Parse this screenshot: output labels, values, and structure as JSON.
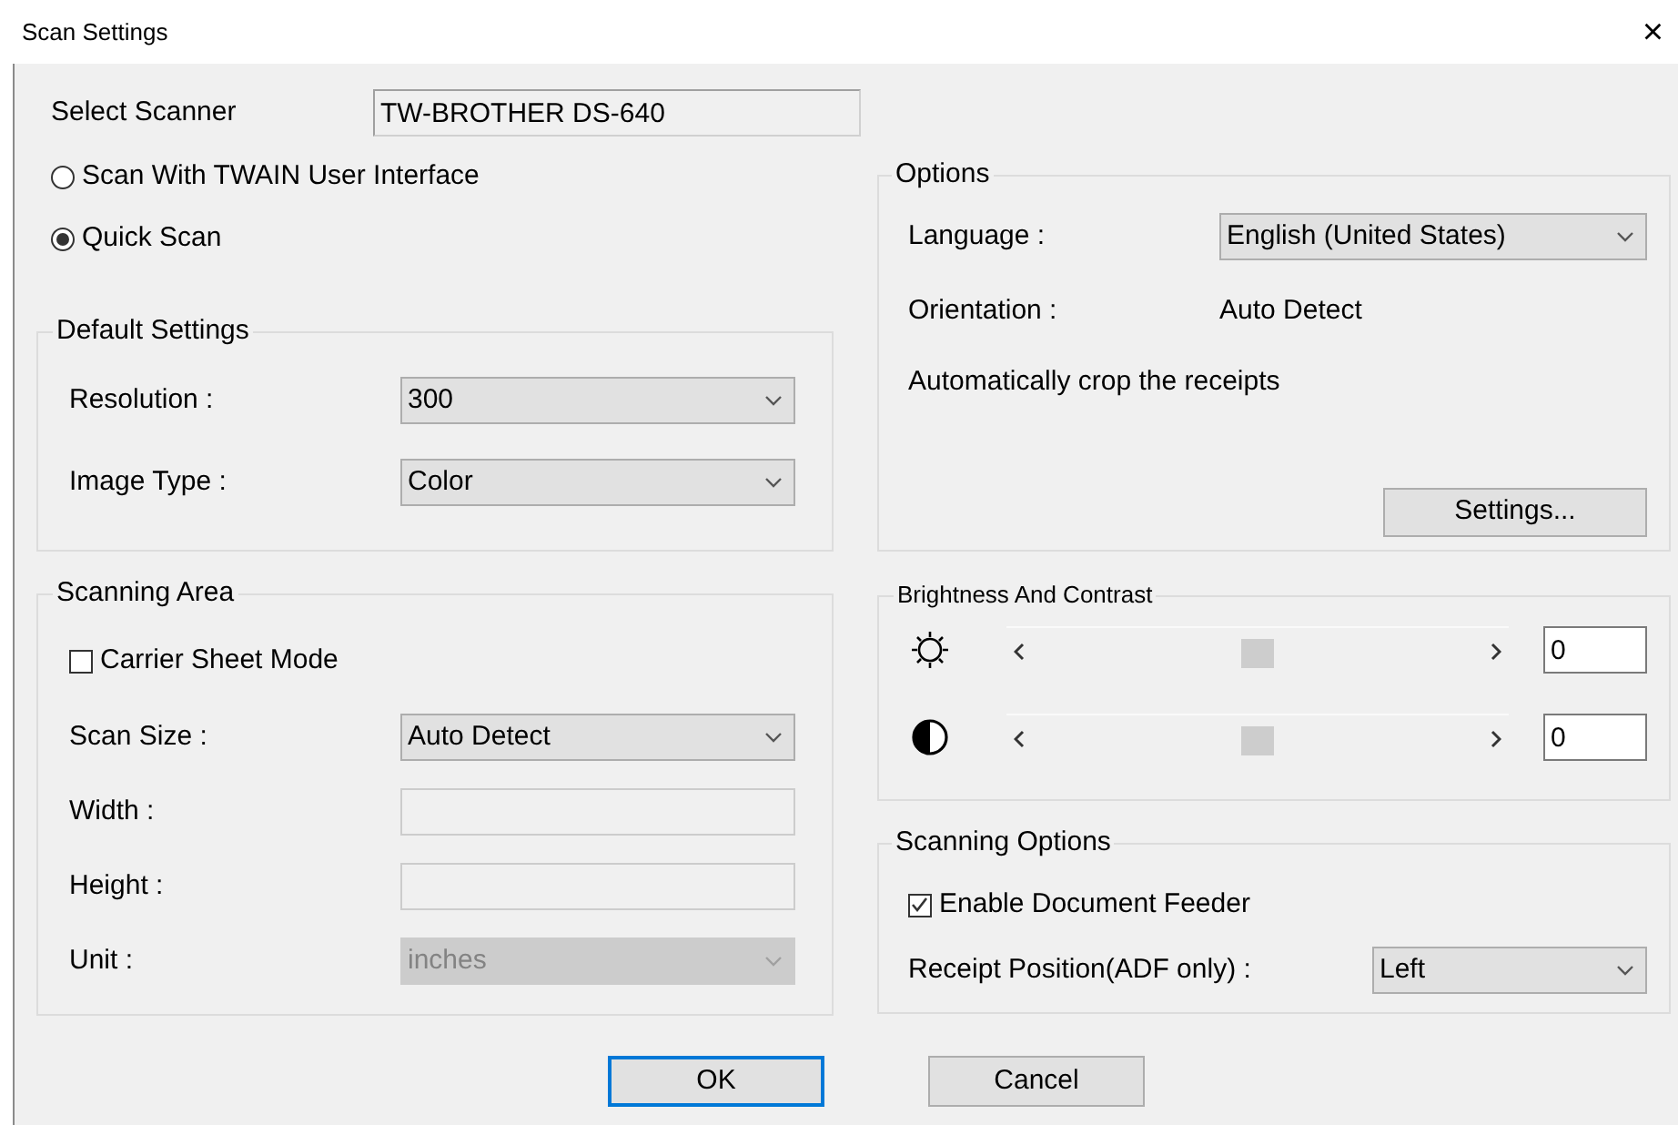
{
  "window": {
    "title": "Scan Settings",
    "close": "×"
  },
  "scanner": {
    "label": "Select Scanner",
    "value": "TW-BROTHER DS-640"
  },
  "scan_modes": [
    {
      "label": "Scan With TWAIN User Interface",
      "selected": false
    },
    {
      "label": "Quick Scan",
      "selected": true
    }
  ],
  "default_settings": {
    "title": "Default Settings",
    "fields": [
      {
        "label": "Resolution :",
        "kind": "dropdown",
        "value": "300",
        "disabled": false
      },
      {
        "label": "Image Type :",
        "kind": "dropdown",
        "value": "Color",
        "disabled": false
      }
    ]
  },
  "scanning_area": {
    "title": "Scanning Area",
    "carrier_sheet": {
      "label": "Carrier Sheet Mode",
      "checked": false
    },
    "fields": [
      {
        "label": "Scan Size :",
        "kind": "dropdown",
        "value": "Auto Detect",
        "disabled": false
      },
      {
        "label": "Width :",
        "kind": "text",
        "disabled": true
      },
      {
        "label": "Height :",
        "kind": "text",
        "disabled": true
      },
      {
        "label": "Unit :",
        "kind": "dropdown",
        "value": "inches",
        "disabled": true
      }
    ]
  },
  "options": {
    "title": "Options",
    "language": {
      "label": "Language :",
      "value": "English (United States)"
    },
    "orientation": {
      "label": "Orientation :",
      "value": "Auto Detect"
    },
    "note": "Automatically crop the receipts",
    "button": "Settings..."
  },
  "brightness_contrast": {
    "title": "Brightness And Contrast",
    "sliders": [
      {
        "kind": "brightness",
        "level": 0.5,
        "value": "0"
      },
      {
        "kind": "contrast",
        "level": 0.5,
        "value": "0"
      }
    ]
  },
  "scanning_options": {
    "title": "Scanning Options",
    "feeder": {
      "label": "Enable Document Feeder",
      "checked": true
    },
    "receipt_position": {
      "label": "Receipt Position(ADF only) :",
      "value": "Left"
    }
  },
  "buttons": [
    {
      "label": "OK",
      "default": true
    },
    {
      "label": "Cancel",
      "default": false
    }
  ]
}
